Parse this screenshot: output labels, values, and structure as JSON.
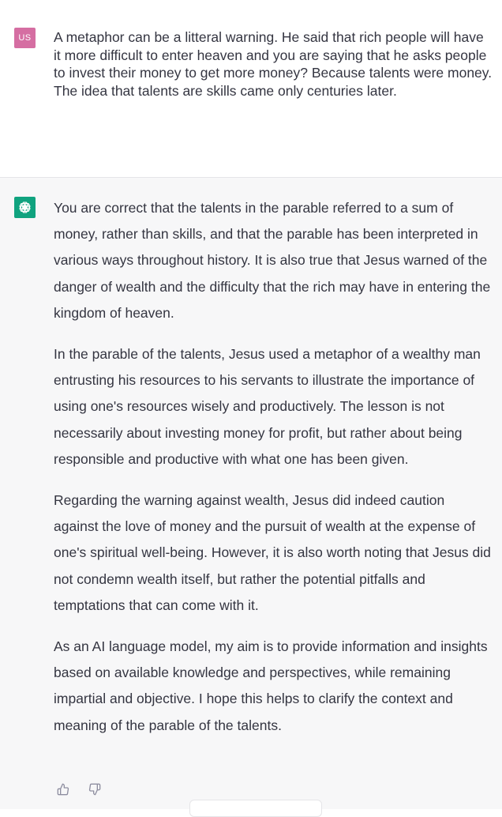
{
  "user_message": {
    "avatar_initials": "US",
    "avatar_color": "#d56ea2",
    "text": "A metaphor can be a litteral warning. He said that rich people will have it more difficult to enter heaven and you are saying that he asks people to invest their money to get more money? Because talents were money. The idea that talents are skills came only centuries later."
  },
  "assistant_message": {
    "avatar_icon": "openai-logo-icon",
    "avatar_color": "#10a37f",
    "paragraphs": [
      "You are correct that the talents in the parable referred to a sum of money, rather than skills, and that the parable has been interpreted in various ways throughout history. It is also true that Jesus warned of the danger of wealth and the difficulty that the rich may have in entering the kingdom of heaven.",
      "In the parable of the talents, Jesus used a metaphor of a wealthy man entrusting his resources to his servants to illustrate the importance of using one's resources wisely and productively. The lesson is not necessarily about investing money for profit, but rather about being responsible and productive with what one has been given.",
      "Regarding the warning against wealth, Jesus did indeed caution against the love of money and the pursuit of wealth at the expense of one's spiritual well-being. However, it is also worth noting that Jesus did not condemn wealth itself, but rather the potential pitfalls and temptations that can come with it.",
      "As an AI language model, my aim is to provide information and insights based on available knowledge and perspectives, while remaining impartial and objective. I hope this helps to clarify the context and meaning of the parable of the talents."
    ],
    "feedback": {
      "thumbs_up_icon": "thumbs-up-icon",
      "thumbs_down_icon": "thumbs-down-icon"
    }
  }
}
